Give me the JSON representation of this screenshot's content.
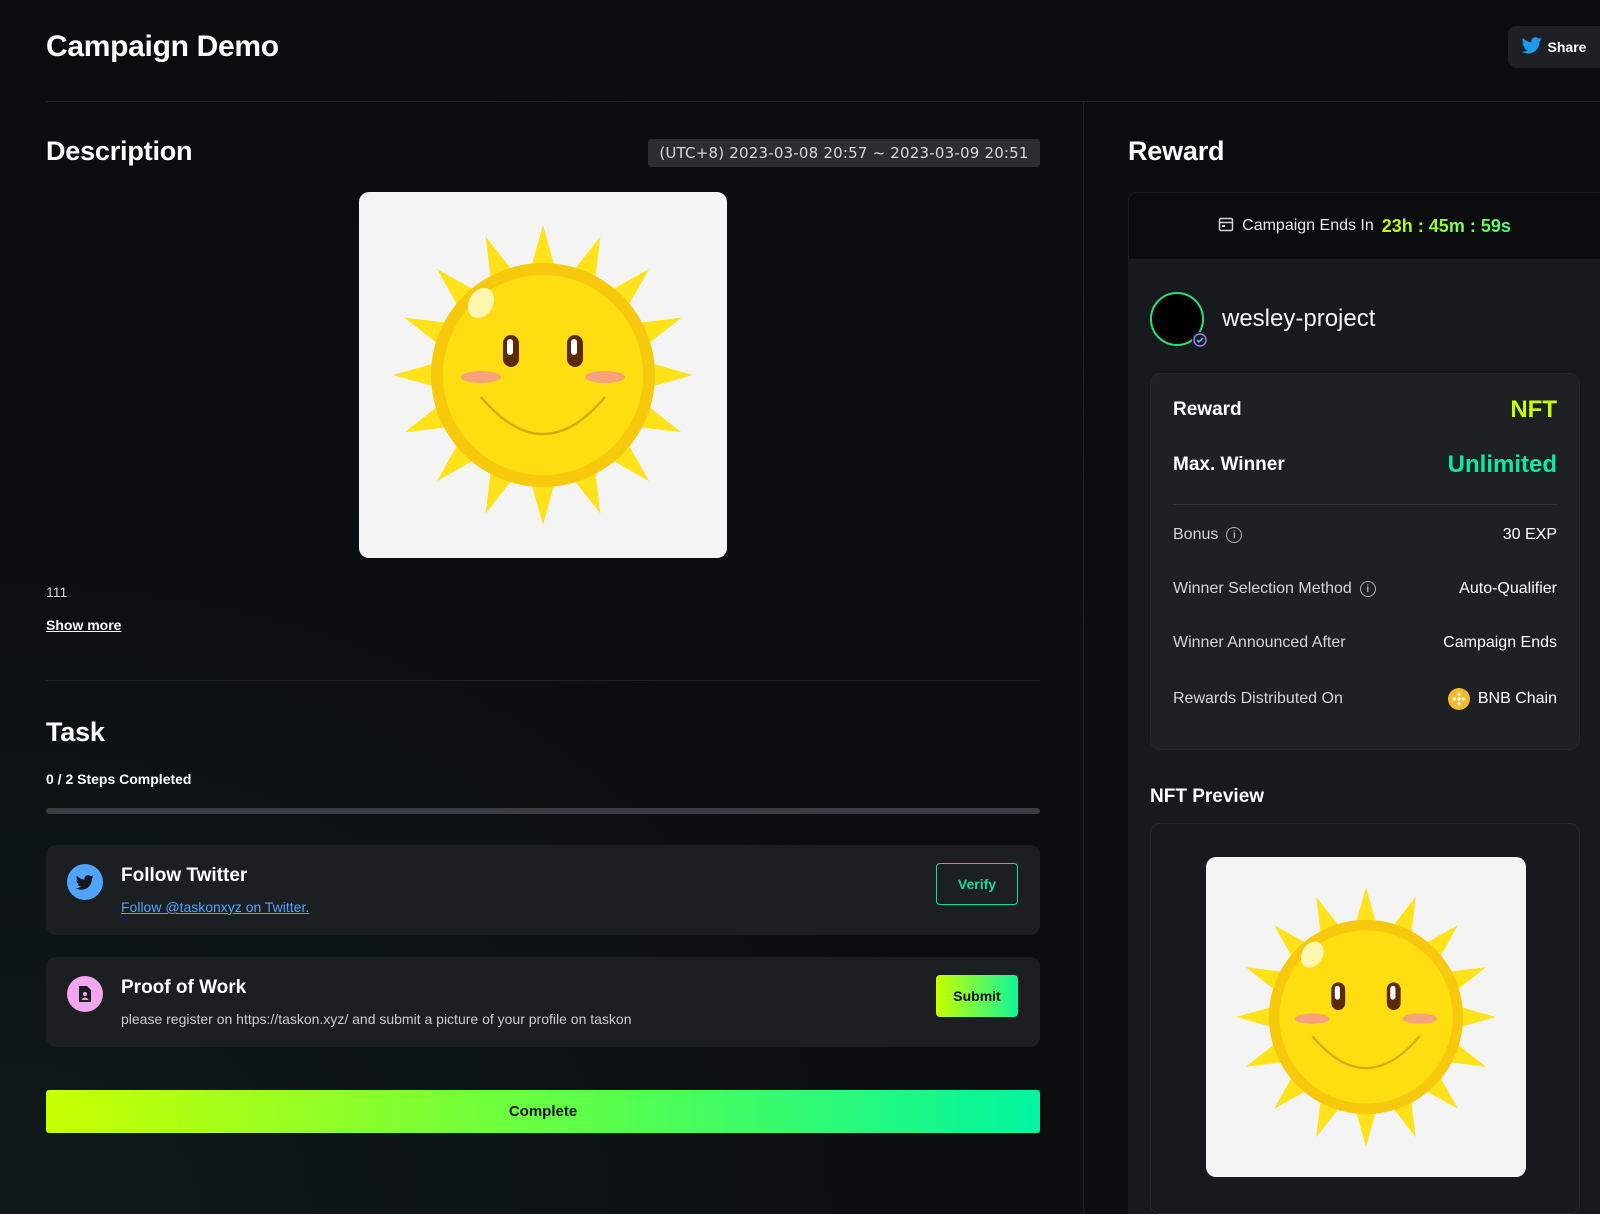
{
  "header": {
    "title": "Campaign Demo",
    "share_label": "Share",
    "share_icon": "twitter-bird-icon"
  },
  "description": {
    "heading": "Description",
    "date_range": "(UTC+8) 2023-03-08 20:57 ~ 2023-03-09 20:51",
    "body_text": "111",
    "show_more_label": "Show more"
  },
  "task": {
    "heading": "Task",
    "steps_text": "0 / 2 Steps Completed",
    "progress": 0,
    "items": [
      {
        "title": "Follow Twitter",
        "subtitle": "Follow @taskonxyz on Twitter.",
        "icon": "twitter-bird-icon",
        "action_label": "Verify"
      },
      {
        "title": "Proof of Work",
        "subtitle": "please register on https://taskon.xyz/ and submit a picture of your profile on taskon",
        "icon": "document-icon",
        "action_label": "Submit"
      }
    ],
    "complete_label": "Complete"
  },
  "reward": {
    "heading": "Reward",
    "timer_label": "Campaign Ends In",
    "timer_value": "23h : 45m : 59s",
    "project_name": "wesley-project",
    "reward_label": "Reward",
    "reward_value": "NFT",
    "max_winner_label": "Max. Winner",
    "max_winner_value": "Unlimited",
    "bonus_label": "Bonus",
    "bonus_value": "30 EXP",
    "selection_label": "Winner Selection Method",
    "selection_value": "Auto-Qualifier",
    "announced_label": "Winner Announced After",
    "announced_value": "Campaign Ends",
    "distributed_label": "Rewards Distributed On",
    "distributed_value": "BNB Chain",
    "nft_preview_heading": "NFT Preview"
  },
  "colors": {
    "accent_lime": "#c8ff00",
    "accent_green": "#10e8a0",
    "twitter_blue": "#4ea4ff",
    "bnb_gold": "#f3ba2f"
  }
}
